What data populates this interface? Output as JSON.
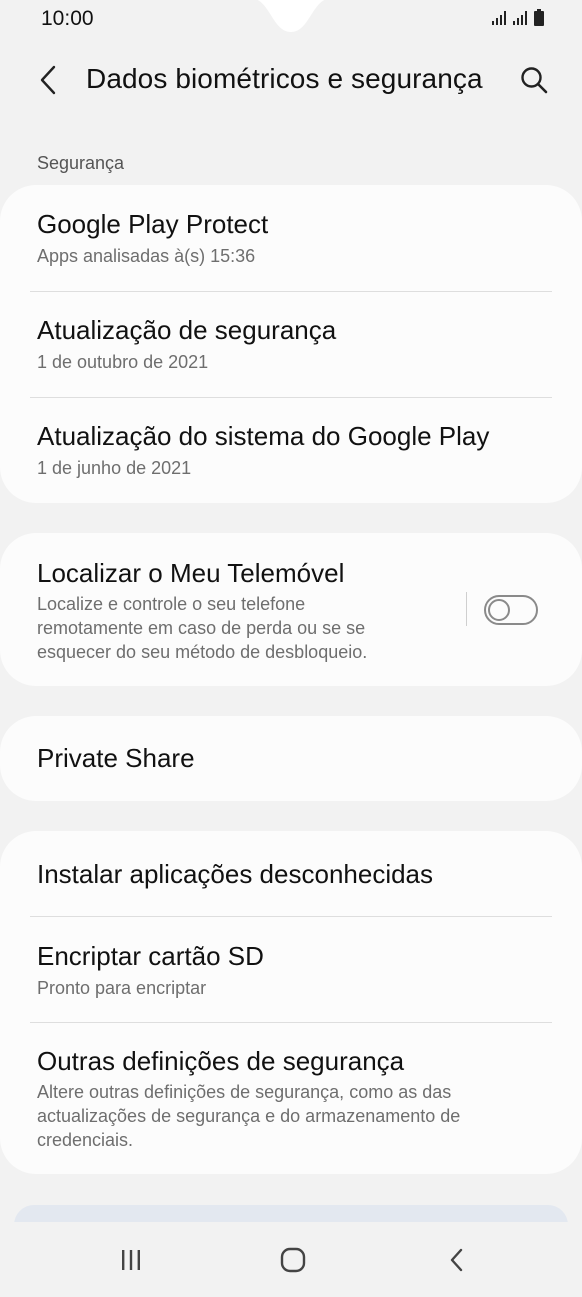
{
  "status": {
    "time": "10:00"
  },
  "header": {
    "title": "Dados biométricos e segurança",
    "back_icon": "chevron-left-icon",
    "search_icon": "search-icon"
  },
  "section": {
    "label": "Segurança"
  },
  "security_card": {
    "items": [
      {
        "title": "Google Play Protect",
        "subtitle": "Apps analisadas à(s) 15:36"
      },
      {
        "title": "Atualização de segurança",
        "subtitle": "1 de outubro de 2021"
      },
      {
        "title": "Atualização do sistema do Google Play",
        "subtitle": "1 de junho de 2021"
      }
    ]
  },
  "find_device": {
    "title": "Localizar o Meu Telemóvel",
    "subtitle_lines": [
      "Localize e controle o seu telefone",
      "remotamente em caso de perda ou se se",
      "esquecer do seu método de desbloqueio."
    ],
    "toggle_on": false
  },
  "private_share": {
    "title": "Private Share"
  },
  "other_card": {
    "items": [
      {
        "title": "Instalar aplicações desconhecidas"
      },
      {
        "title": "Encriptar cartão SD",
        "subtitle": "Pronto para encriptar"
      },
      {
        "title": "Outras definições de segurança",
        "subtitle_lines": [
          "Altere outras definições de segurança, como as das",
          "actualizações de segurança e do armazenamento de",
          "credenciais."
        ]
      }
    ]
  },
  "nav": {
    "recents_icon": "recents-icon",
    "home_icon": "home-icon",
    "back_icon": "back-icon"
  },
  "colors": {
    "background": "#f2f2f2",
    "card": "#fcfcfc",
    "text": "#111111",
    "subtext": "#6e6e6e"
  }
}
